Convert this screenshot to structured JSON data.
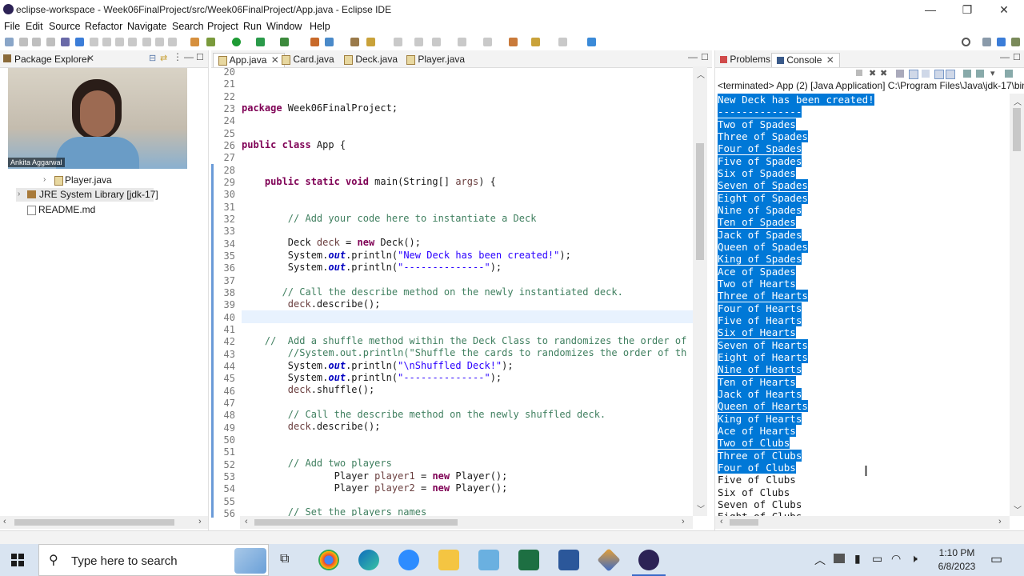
{
  "window": {
    "title": "eclipse-workspace - Week06FinalProject/src/Week06FinalProject/App.java - Eclipse IDE",
    "minimize": "—",
    "restore": "❐",
    "close": "✕"
  },
  "menu": [
    "File",
    "Edit",
    "Source",
    "Refactor",
    "Navigate",
    "Search",
    "Project",
    "Run",
    "Window",
    "Help"
  ],
  "package_explorer": {
    "tab_label": "Package Explorer",
    "webcam_name": "Ankita Aggarwal",
    "items": [
      {
        "label": "Player.java"
      },
      {
        "label": "JRE System Library [jdk-17]"
      },
      {
        "label": "README.md"
      }
    ]
  },
  "editor": {
    "tabs": [
      {
        "label": "App.java",
        "active": true
      },
      {
        "label": "Card.java",
        "active": false
      },
      {
        "label": "Deck.java",
        "active": false
      },
      {
        "label": "Player.java",
        "active": false
      }
    ],
    "line_numbers": [
      "20",
      "21",
      "22",
      "23",
      "24",
      "25",
      "26",
      "27",
      "28",
      "29",
      "30",
      "31",
      "32",
      "33",
      "34",
      "35",
      "36",
      "37",
      "38",
      "39",
      "40",
      "41",
      "42",
      "43",
      "44",
      "45",
      "46",
      "47",
      "48",
      "49",
      "50",
      "51",
      "52",
      "53",
      "54",
      "55",
      "56"
    ]
  },
  "console": {
    "tab_problems": "Problems",
    "tab_console": "Console",
    "status": "<terminated> App (2) [Java Application] C:\\Program Files\\Java\\jdk-17\\bin",
    "selected_lines": [
      "New Deck has been created!",
      "--------------",
      "Two of Spades",
      "Three of Spades",
      "Four of Spades",
      "Five of Spades",
      "Six of Spades",
      "Seven of Spades",
      "Eight of Spades",
      "Nine of Spades",
      "Ten of Spades",
      "Jack of Spades",
      "Queen of Spades",
      "King of Spades",
      "Ace of Spades",
      "Two of Hearts",
      "Three of Hearts",
      "Four of Hearts",
      "Five of Hearts",
      "Six of Hearts",
      "Seven of Hearts",
      "Eight of Hearts",
      "Nine of Hearts",
      "Ten of Hearts",
      "Jack of Hearts",
      "Queen of Hearts",
      "King of Hearts",
      "Ace of Hearts",
      "Two of Clubs",
      "Three of Clubs",
      "Four of Clubs"
    ],
    "plain_lines": [
      "Five of Clubs",
      "Six of Clubs",
      "Seven of Clubs",
      "Eight of Clubs"
    ]
  },
  "taskbar": {
    "search_placeholder": "Type here to search",
    "time": "1:10 PM",
    "date": "6/8/2023"
  }
}
